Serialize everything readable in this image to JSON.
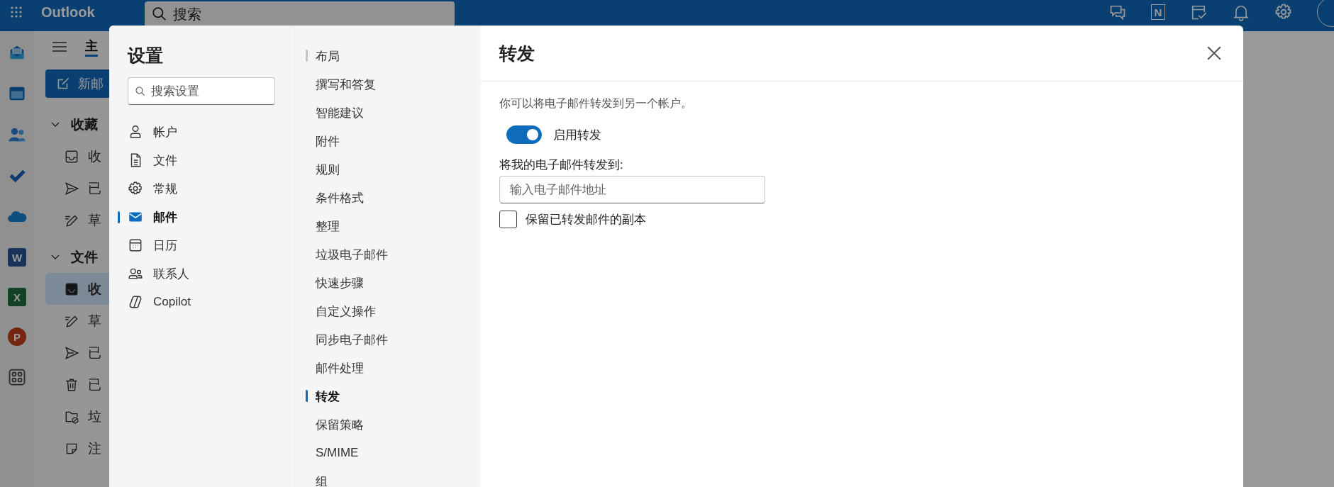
{
  "top_bar": {
    "app_name": "Outlook",
    "search": {
      "placeholder": "搜索"
    },
    "tools": [
      {
        "kind": "chat"
      },
      {
        "kind": "notebook",
        "glyph": "N"
      },
      {
        "kind": "task"
      },
      {
        "kind": "bell"
      },
      {
        "kind": "gear"
      },
      {
        "kind": "avatar"
      }
    ]
  },
  "app_rail": [
    {
      "kind": "mail"
    },
    {
      "kind": "calendar"
    },
    {
      "kind": "people"
    },
    {
      "kind": "check"
    },
    {
      "kind": "cloud"
    },
    {
      "kind": "document",
      "glyph": "W"
    },
    {
      "kind": "spreadsheet",
      "glyph": "X"
    },
    {
      "kind": "presentation",
      "glyph": "P"
    },
    {
      "kind": "apps"
    }
  ],
  "folder_pane": {
    "tab": "主",
    "new_button": "新邮",
    "sections": [
      {
        "heading": "收藏",
        "items": [
          {
            "kind": "inbox",
            "label": "收",
            "selected": false
          },
          {
            "kind": "send",
            "label": "已",
            "selected": false
          },
          {
            "kind": "pen",
            "label": "草",
            "selected": false
          }
        ]
      },
      {
        "heading": "文件",
        "items": [
          {
            "kind": "inbox",
            "label": "收",
            "selected": true
          },
          {
            "kind": "pen",
            "label": "草",
            "selected": false
          },
          {
            "kind": "send",
            "label": "已",
            "selected": false
          },
          {
            "kind": "trash",
            "label": "已",
            "selected": false
          },
          {
            "kind": "junk",
            "label": "垃",
            "selected": false
          },
          {
            "kind": "note",
            "label": "注",
            "selected": false
          }
        ]
      }
    ]
  },
  "settings": {
    "title": "设置",
    "search": {
      "placeholder": "搜索设置"
    },
    "categories": [
      {
        "kind": "person",
        "label": "帐户",
        "selected": false
      },
      {
        "kind": "file",
        "label": "文件",
        "selected": false
      },
      {
        "kind": "gear",
        "label": "常规",
        "selected": false
      },
      {
        "kind": "mail",
        "label": "邮件",
        "selected": true
      },
      {
        "kind": "calendar",
        "label": "日历",
        "selected": false
      },
      {
        "kind": "people",
        "label": "联系人",
        "selected": false
      },
      {
        "kind": "copilot",
        "label": "Copilot",
        "selected": false
      }
    ],
    "subcategories": [
      {
        "label": "布局",
        "selected": false,
        "hovered": true
      },
      {
        "label": "撰写和答复",
        "selected": false,
        "hovered": false
      },
      {
        "label": "智能建议",
        "selected": false,
        "hovered": false
      },
      {
        "label": "附件",
        "selected": false,
        "hovered": false
      },
      {
        "label": "规则",
        "selected": false,
        "hovered": false
      },
      {
        "label": "条件格式",
        "selected": false,
        "hovered": false
      },
      {
        "label": "整理",
        "selected": false,
        "hovered": false
      },
      {
        "label": "垃圾电子邮件",
        "selected": false,
        "hovered": false
      },
      {
        "label": "快速步骤",
        "selected": false,
        "hovered": false
      },
      {
        "label": "自定义操作",
        "selected": false,
        "hovered": false
      },
      {
        "label": "同步电子邮件",
        "selected": false,
        "hovered": false
      },
      {
        "label": "邮件处理",
        "selected": false,
        "hovered": false
      },
      {
        "label": "转发",
        "selected": true,
        "hovered": false
      },
      {
        "label": "保留策略",
        "selected": false,
        "hovered": false
      },
      {
        "label": "S/MIME",
        "selected": false,
        "hovered": false
      },
      {
        "label": "组",
        "selected": false,
        "hovered": false
      }
    ],
    "page": {
      "title": "转发",
      "description": "你可以将电子邮件转发到另一个帐户。",
      "toggle": {
        "label": "启用转发",
        "on": true
      },
      "field": {
        "label": "将我的电子邮件转发到:",
        "placeholder": "输入电子邮件地址"
      },
      "checkbox": {
        "label": "保留已转发邮件的副本",
        "checked": false
      }
    }
  }
}
